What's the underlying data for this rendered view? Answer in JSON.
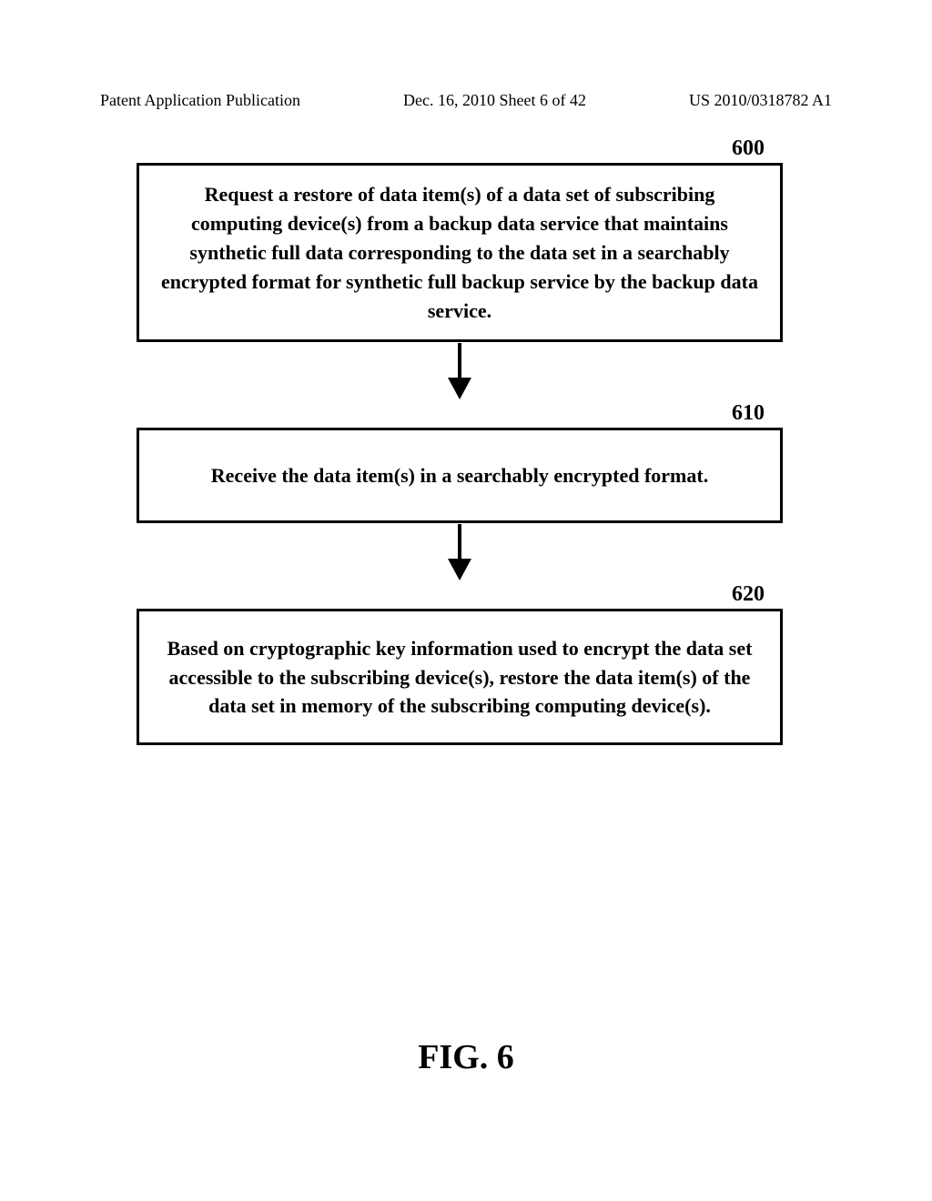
{
  "header": {
    "left": "Patent Application Publication",
    "center": "Dec. 16, 2010  Sheet 6 of 42",
    "right": "US 2010/0318782 A1"
  },
  "steps": [
    {
      "label": "600",
      "text": "Request a restore of data item(s) of a data set of subscribing computing device(s) from a backup data service that maintains synthetic full data corresponding to the data set in a searchably encrypted format for synthetic full backup service by the backup data service."
    },
    {
      "label": "610",
      "text": "Receive the data item(s) in a searchably encrypted format."
    },
    {
      "label": "620",
      "text": "Based on cryptographic key information used to encrypt the data set accessible to the subscribing device(s), restore the data item(s) of the data set in memory of the subscribing computing device(s)."
    }
  ],
  "figure_caption": "FIG. 6"
}
